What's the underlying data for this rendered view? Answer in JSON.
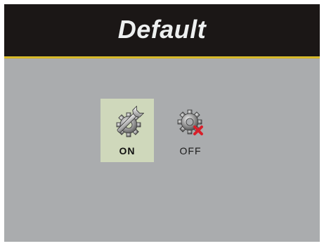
{
  "header": {
    "title": "Default"
  },
  "colors": {
    "header_bg": "#1b1716",
    "accent_line": "#e0c22a",
    "screen_bg": "#aaacae",
    "selected_bg": "#cfd8bb",
    "off_mark": "#d81f2a"
  },
  "options": [
    {
      "label": "ON",
      "icon": "gear-wrench-icon",
      "selected": true
    },
    {
      "label": "OFF",
      "icon": "gear-cross-icon",
      "selected": false
    }
  ]
}
